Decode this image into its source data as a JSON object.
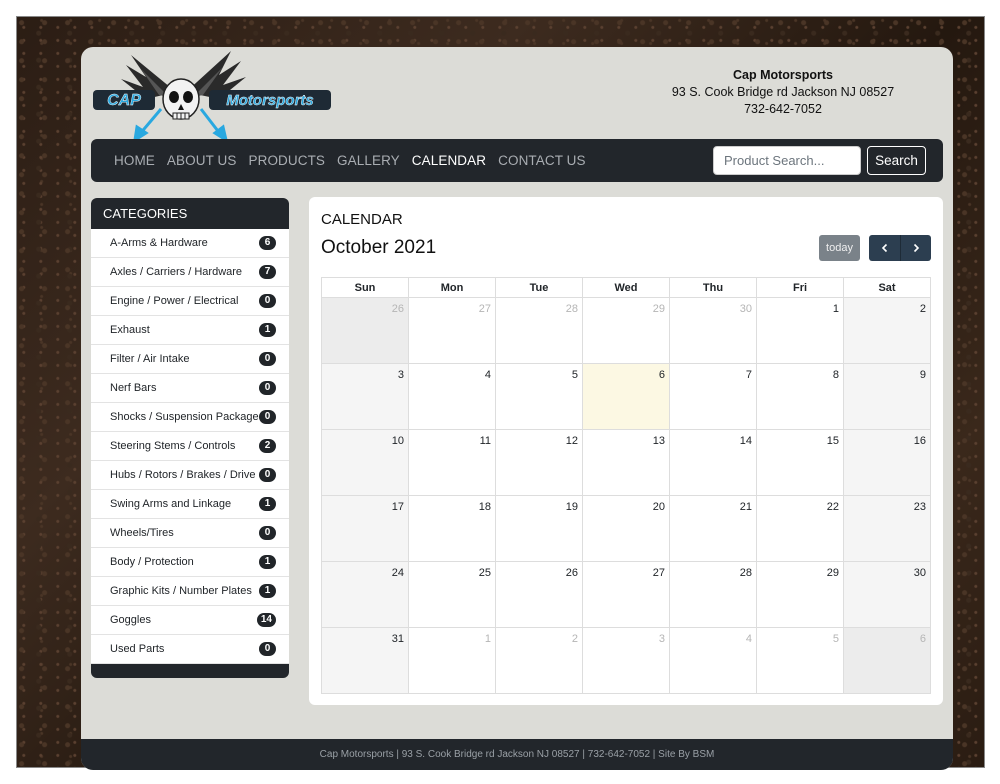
{
  "header": {
    "logo_text_left": "CAP",
    "logo_text_right": "Motorsports",
    "company_name": "Cap Motorsports",
    "address": "93 S. Cook Bridge rd Jackson NJ 08527",
    "phone": "732-642-7052"
  },
  "nav": {
    "items": [
      {
        "label": "HOME"
      },
      {
        "label": "ABOUT US"
      },
      {
        "label": "PRODUCTS"
      },
      {
        "label": "GALLERY"
      },
      {
        "label": "CALENDAR",
        "active": true
      },
      {
        "label": "CONTACT US"
      }
    ],
    "search_placeholder": "Product Search...",
    "search_button": "Search"
  },
  "categories": {
    "title": "CATEGORIES",
    "items": [
      {
        "label": "A-Arms & Hardware",
        "count": "6"
      },
      {
        "label": "Axles / Carriers / Hardware",
        "count": "7"
      },
      {
        "label": "Engine / Power / Electrical",
        "count": "0"
      },
      {
        "label": "Exhaust",
        "count": "1"
      },
      {
        "label": "Filter / Air Intake",
        "count": "0"
      },
      {
        "label": "Nerf Bars",
        "count": "0"
      },
      {
        "label": "Shocks / Suspension Package",
        "count": "0"
      },
      {
        "label": "Steering Stems / Controls",
        "count": "2"
      },
      {
        "label": "Hubs / Rotors / Brakes / Drive",
        "count": "0"
      },
      {
        "label": "Swing Arms and Linkage",
        "count": "1"
      },
      {
        "label": "Wheels/Tires",
        "count": "0"
      },
      {
        "label": "Body / Protection",
        "count": "1"
      },
      {
        "label": "Graphic Kits / Number Plates",
        "count": "1"
      },
      {
        "label": "Goggles",
        "count": "14"
      },
      {
        "label": "Used Parts",
        "count": "0"
      }
    ]
  },
  "calendar": {
    "heading": "CALENDAR",
    "month": "October 2021",
    "today_label": "today",
    "prev_icon": "chevron-left-icon",
    "next_icon": "chevron-right-icon",
    "weekdays": [
      "Sun",
      "Mon",
      "Tue",
      "Wed",
      "Thu",
      "Fri",
      "Sat"
    ],
    "weeks": [
      [
        {
          "d": "26",
          "other": true
        },
        {
          "d": "27",
          "other": true
        },
        {
          "d": "28",
          "other": true
        },
        {
          "d": "29",
          "other": true
        },
        {
          "d": "30",
          "other": true
        },
        {
          "d": "1"
        },
        {
          "d": "2"
        }
      ],
      [
        {
          "d": "3"
        },
        {
          "d": "4"
        },
        {
          "d": "5"
        },
        {
          "d": "6",
          "today": true
        },
        {
          "d": "7"
        },
        {
          "d": "8"
        },
        {
          "d": "9"
        }
      ],
      [
        {
          "d": "10"
        },
        {
          "d": "11"
        },
        {
          "d": "12"
        },
        {
          "d": "13"
        },
        {
          "d": "14"
        },
        {
          "d": "15"
        },
        {
          "d": "16"
        }
      ],
      [
        {
          "d": "17"
        },
        {
          "d": "18"
        },
        {
          "d": "19"
        },
        {
          "d": "20"
        },
        {
          "d": "21"
        },
        {
          "d": "22"
        },
        {
          "d": "23"
        }
      ],
      [
        {
          "d": "24"
        },
        {
          "d": "25"
        },
        {
          "d": "26"
        },
        {
          "d": "27"
        },
        {
          "d": "28"
        },
        {
          "d": "29"
        },
        {
          "d": "30"
        }
      ],
      [
        {
          "d": "31"
        },
        {
          "d": "1",
          "other": true
        },
        {
          "d": "2",
          "other": true
        },
        {
          "d": "3",
          "other": true
        },
        {
          "d": "4",
          "other": true
        },
        {
          "d": "5",
          "other": true
        },
        {
          "d": "6",
          "other": true
        }
      ]
    ]
  },
  "footer": {
    "text": "Cap Motorsports | 93 S. Cook Bridge rd Jackson NJ 08527 | 732-642-7052 | Site By BSM"
  },
  "colors": {
    "navbar": "#22262b",
    "panel": "#dcdcd7",
    "today_highlight": "#fcf8e3",
    "accent_blue": "#29a8e0"
  }
}
